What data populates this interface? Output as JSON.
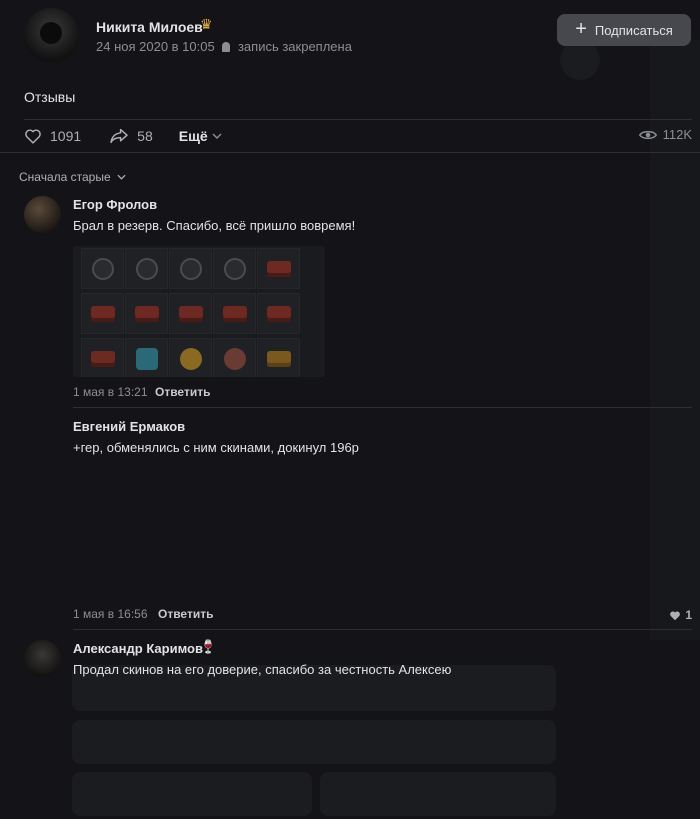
{
  "post": {
    "author_name": "Никита Милоев",
    "author_badge_icon": "crown-icon",
    "date": "24 ноя 2020 в 10:05",
    "pinned_label": "запись закреплена",
    "subscribe_label": "Подписаться",
    "text": "Отзывы",
    "likes": "1091",
    "shares": "58",
    "more_label": "Ещё",
    "views": "112K"
  },
  "comments_sort": "Сначала старые",
  "comments": [
    {
      "author": "Егор Фролов",
      "text": "Брал в резерв. Спасибо, всё пришло вовремя!",
      "time": "1 мая в 13:21",
      "reply_label": "Ответить"
    },
    {
      "author": "Евгений Ермаков",
      "text": "+гер, обменялись с ним скинами, докинул 196р",
      "time": "1 мая в 16:56",
      "reply_label": "Ответить",
      "likes": "1"
    },
    {
      "author": "Александр Каримов",
      "author_badge_icon": "wine-glass-icon",
      "text": "Продал скинов на его доверие, спасибо за честность Алексею"
    }
  ],
  "colors": {
    "background": "#141418",
    "text_primary": "#e1e3e6",
    "text_secondary": "#8c8e93",
    "button_bg": "#46484d",
    "divider": "#2e2f34"
  }
}
